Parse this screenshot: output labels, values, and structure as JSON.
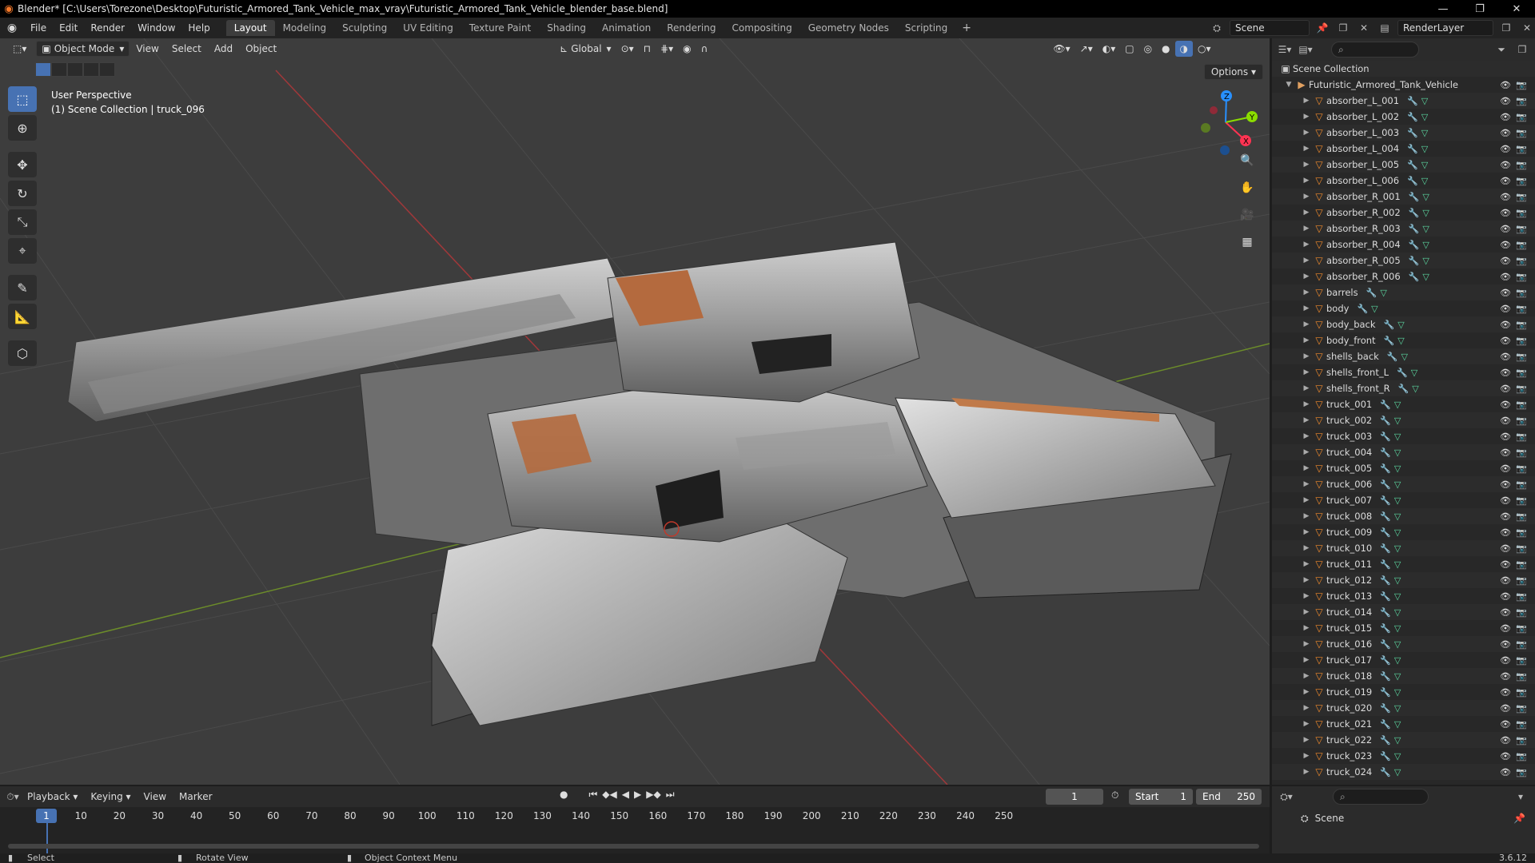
{
  "window": {
    "title": "Blender* [C:\\Users\\Torezone\\Desktop\\Futuristic_Armored_Tank_Vehicle_max_vray\\Futuristic_Armored_Tank_Vehicle_blender_base.blend]",
    "minimize": "—",
    "restore": "❐",
    "close": "✕"
  },
  "menus": [
    "File",
    "Edit",
    "Render",
    "Window",
    "Help"
  ],
  "workspaces": [
    "Layout",
    "Modeling",
    "Sculpting",
    "UV Editing",
    "Texture Paint",
    "Shading",
    "Animation",
    "Rendering",
    "Compositing",
    "Geometry Nodes",
    "Scripting"
  ],
  "workspace_add": "+",
  "scene_selector": {
    "scene": "Scene",
    "view_layer": "RenderLayer"
  },
  "viewport": {
    "mode": "Object Mode",
    "menus": [
      "View",
      "Select",
      "Add",
      "Object"
    ],
    "transform_orientation": "Global",
    "options": "Options",
    "info_line1": "User Perspective",
    "info_line2": "(1) Scene Collection | truck_096",
    "gizmo_axes": {
      "x": "X",
      "y": "Y",
      "z": "Z"
    }
  },
  "outliner": {
    "root": "Scene Collection",
    "collection": "Futuristic_Armored_Tank_Vehicle",
    "items": [
      "absorber_L_001",
      "absorber_L_002",
      "absorber_L_003",
      "absorber_L_004",
      "absorber_L_005",
      "absorber_L_006",
      "absorber_R_001",
      "absorber_R_002",
      "absorber_R_003",
      "absorber_R_004",
      "absorber_R_005",
      "absorber_R_006",
      "barrels",
      "body",
      "body_back",
      "body_front",
      "shells_back",
      "shells_front_L",
      "shells_front_R",
      "truck_001",
      "truck_002",
      "truck_003",
      "truck_004",
      "truck_005",
      "truck_006",
      "truck_007",
      "truck_008",
      "truck_009",
      "truck_010",
      "truck_011",
      "truck_012",
      "truck_013",
      "truck_014",
      "truck_015",
      "truck_016",
      "truck_017",
      "truck_018",
      "truck_019",
      "truck_020",
      "truck_021",
      "truck_022",
      "truck_023",
      "truck_024"
    ]
  },
  "properties": {
    "scene": "Scene"
  },
  "timeline": {
    "menus": [
      "Playback",
      "Keying",
      "View",
      "Marker"
    ],
    "current_frame": "1",
    "start_label": "Start",
    "start": "1",
    "end_label": "End",
    "end": "250",
    "ticks": [
      "10",
      "20",
      "30",
      "40",
      "50",
      "60",
      "70",
      "80",
      "90",
      "100",
      "110",
      "120",
      "130",
      "140",
      "150",
      "160",
      "170",
      "180",
      "190",
      "200",
      "210",
      "220",
      "230",
      "240",
      "250"
    ],
    "cursor_label": "1"
  },
  "statusbar": {
    "select": "Select",
    "rotate": "Rotate View",
    "context": "Object Context Menu",
    "version": "3.6.12"
  },
  "colors": {
    "accent": "#4772b3",
    "object_orange": "#f08a2c",
    "modifier_blue": "#6ea0ff",
    "mesh_green": "#5bd6a0",
    "axis_x": "#ff3352",
    "axis_y": "#8bdc00",
    "axis_z": "#2890ff"
  }
}
